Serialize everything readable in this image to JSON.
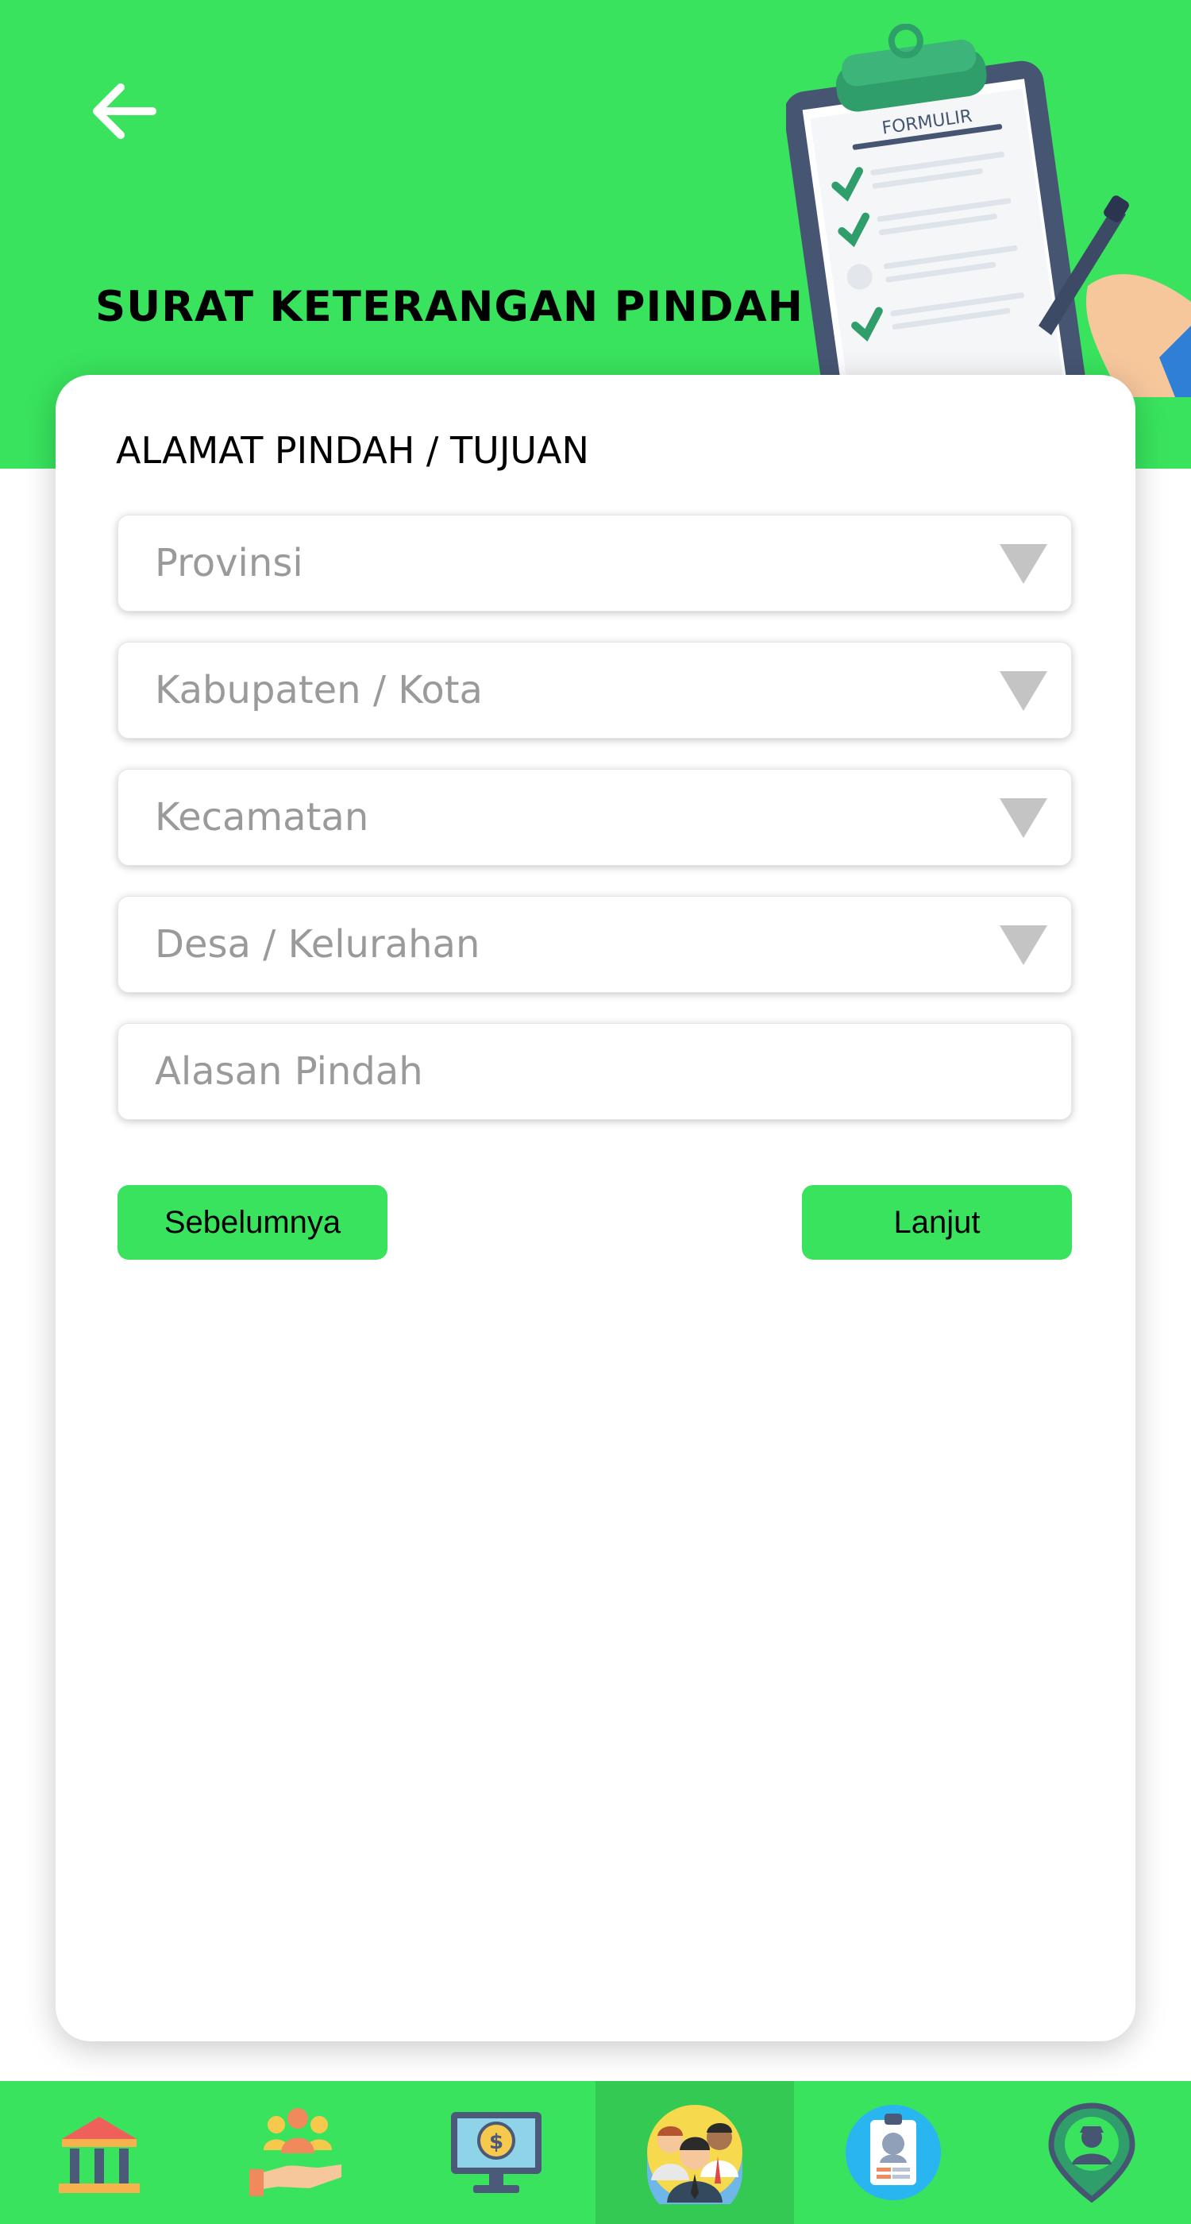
{
  "header": {
    "title": "SURAT KETERANGAN PINDAH",
    "illustration_label": "FORMULIR",
    "background_color": "#39e35d",
    "back_icon": "arrow-left-icon"
  },
  "form": {
    "section_title": "ALAMAT PINDAH / TUJUAN",
    "fields": [
      {
        "placeholder": "Provinsi",
        "type": "dropdown"
      },
      {
        "placeholder": "Kabupaten / Kota",
        "type": "dropdown"
      },
      {
        "placeholder": "Kecamatan",
        "type": "dropdown"
      },
      {
        "placeholder": "Desa / Kelurahan",
        "type": "dropdown"
      },
      {
        "placeholder": "Alasan Pindah",
        "type": "text"
      }
    ],
    "prev_label": "Sebelumnya",
    "next_label": "Lanjut",
    "button_color": "#39e35d"
  },
  "bottom_nav": {
    "items": [
      {
        "icon": "government-building-icon"
      },
      {
        "icon": "community-hand-icon"
      },
      {
        "icon": "money-monitor-icon"
      },
      {
        "icon": "people-group-icon",
        "active": true
      },
      {
        "icon": "id-card-icon"
      },
      {
        "icon": "location-person-icon"
      }
    ]
  }
}
